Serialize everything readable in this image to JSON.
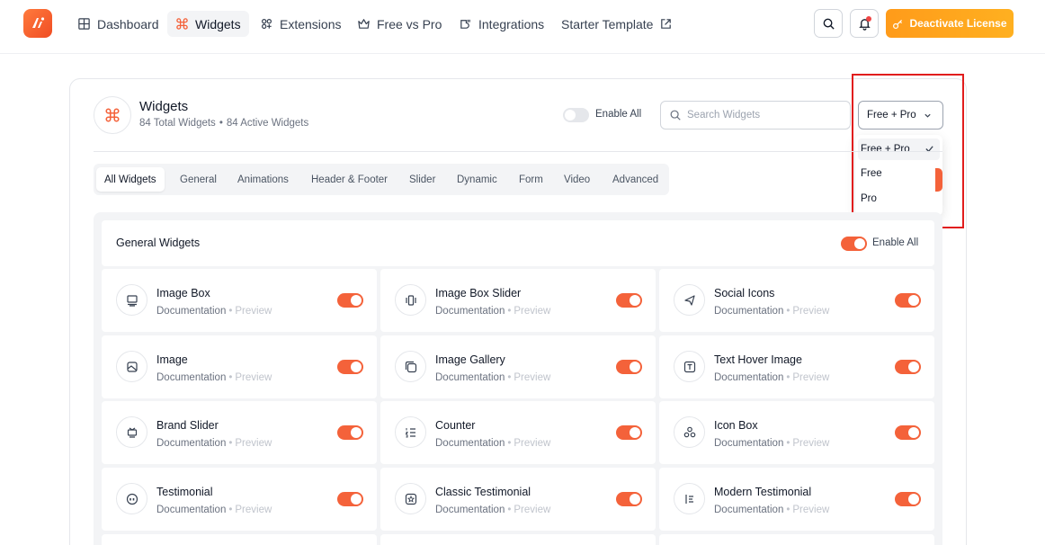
{
  "nav": {
    "items": [
      {
        "label": "Dashboard",
        "icon": "grid-icon"
      },
      {
        "label": "Widgets",
        "icon": "command-icon",
        "active": true
      },
      {
        "label": "Extensions",
        "icon": "puzzle-icon"
      },
      {
        "label": "Free vs Pro",
        "icon": "crown-icon"
      },
      {
        "label": "Integrations",
        "icon": "plug-icon"
      },
      {
        "label": "Starter Template",
        "icon": "external-link-icon"
      }
    ],
    "deactivate_label": "Deactivate License"
  },
  "header": {
    "title": "Widgets",
    "total": "84 Total Widgets",
    "active": "84 Active Widgets",
    "enable_all_label": "Enable All",
    "enable_all_on": false
  },
  "search": {
    "placeholder": "Search Widgets"
  },
  "filter": {
    "selected": "Free + Pro",
    "options": [
      "Free + Pro",
      "Free",
      "Pro"
    ]
  },
  "tabs": [
    "All Widgets",
    "General",
    "Animations",
    "Header & Footer",
    "Slider",
    "Dynamic",
    "Form",
    "Video",
    "Advanced"
  ],
  "section": {
    "title": "General Widgets",
    "enable_all_label": "Enable All",
    "doc_label": "Documentation",
    "preview_label": "Preview",
    "widgets": [
      {
        "name": "Image Box",
        "icon": "image-box-icon"
      },
      {
        "name": "Image Box Slider",
        "icon": "slider-icon"
      },
      {
        "name": "Social Icons",
        "icon": "social-icon"
      },
      {
        "name": "Image",
        "icon": "image-icon"
      },
      {
        "name": "Image Gallery",
        "icon": "gallery-icon"
      },
      {
        "name": "Text Hover Image",
        "icon": "text-icon"
      },
      {
        "name": "Brand Slider",
        "icon": "brand-icon"
      },
      {
        "name": "Counter",
        "icon": "counter-icon"
      },
      {
        "name": "Icon Box",
        "icon": "icon-box-icon"
      },
      {
        "name": "Testimonial",
        "icon": "quote-icon"
      },
      {
        "name": "Classic Testimonial",
        "icon": "star-box-icon"
      },
      {
        "name": "Modern Testimonial",
        "icon": "list-icon"
      }
    ]
  },
  "colors": {
    "accent": "#f4623a",
    "deactivate": "#ffa51f",
    "highlight": "#e11d1d"
  }
}
